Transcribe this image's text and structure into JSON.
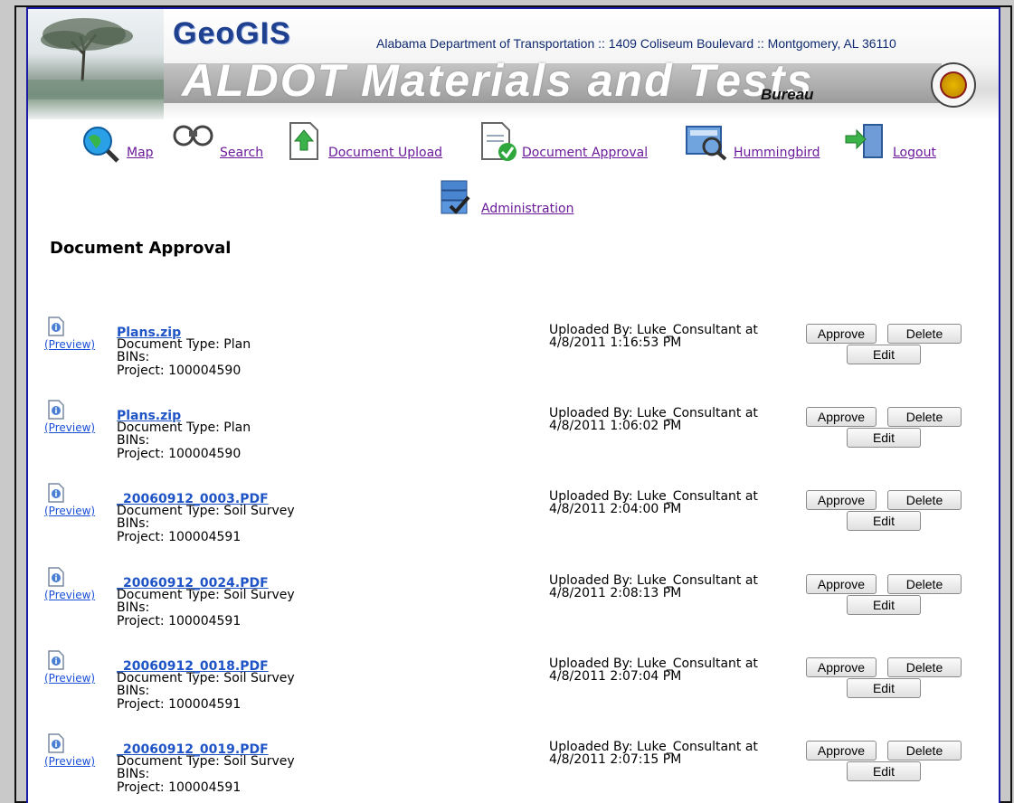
{
  "header": {
    "logo_text": "GeoGIS",
    "agency_line": "Alabama Department of Transportation :: 1409 Coliseum Boulevard :: Montgomery, AL 36110",
    "title": "ALDOT Materials and Tests",
    "subtitle": "Bureau"
  },
  "nav": {
    "map": "Map",
    "search": "Search",
    "upload": "Document Upload",
    "approval": "Document Approval",
    "hummingbird": "Hummingbird",
    "logout": "Logout",
    "administration": "Administration"
  },
  "page_title": "Document Approval",
  "labels": {
    "preview": "(Preview)",
    "doc_type_prefix": "Document Type: ",
    "bins": "BINs:",
    "project_prefix": "Project: ",
    "uploaded_by_prefix": "Uploaded By: ",
    "at": " at",
    "approve": "Approve",
    "delete": "Delete",
    "edit": "Edit"
  },
  "documents": [
    {
      "name": "Plans.zip",
      "doc_type": "Plan",
      "project": "100004590",
      "uploader": "Luke_Consultant",
      "date": "4/8/2011 1:16:53 PM"
    },
    {
      "name": "Plans.zip",
      "doc_type": "Plan",
      "project": "100004590",
      "uploader": "Luke_Consultant",
      "date": "4/8/2011 1:06:02 PM"
    },
    {
      "name": "_20060912_0003.PDF",
      "doc_type": "Soil Survey",
      "project": "100004591",
      "uploader": "Luke_Consultant",
      "date": "4/8/2011 2:04:00 PM"
    },
    {
      "name": "_20060912_0024.PDF",
      "doc_type": "Soil Survey",
      "project": "100004591",
      "uploader": "Luke_Consultant",
      "date": "4/8/2011 2:08:13 PM"
    },
    {
      "name": "_20060912_0018.PDF",
      "doc_type": "Soil Survey",
      "project": "100004591",
      "uploader": "Luke_Consultant",
      "date": "4/8/2011 2:07:04 PM"
    },
    {
      "name": "_20060912_0019.PDF",
      "doc_type": "Soil Survey",
      "project": "100004591",
      "uploader": "Luke_Consultant",
      "date": "4/8/2011 2:07:15 PM"
    }
  ]
}
